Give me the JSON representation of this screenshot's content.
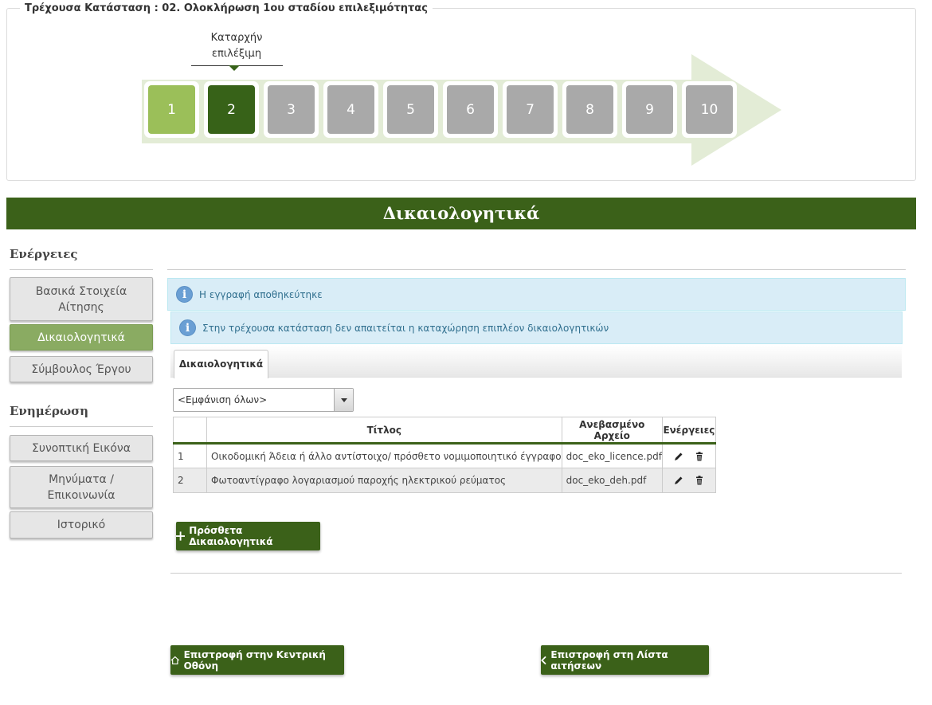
{
  "status": {
    "legend": "Τρέχουσα Κατάσταση : 02. Ολοκλήρωση 1ου σταδίου επιλεξιμότητας",
    "steps": [
      "1",
      "2",
      "3",
      "4",
      "5",
      "6",
      "7",
      "8",
      "9",
      "10"
    ],
    "completed_steps": [
      1
    ],
    "current_step": 2,
    "current_tooltip_line1": "Καταρχήν",
    "current_tooltip_line2": "επιλέξιμη"
  },
  "page_title": "Δικαιολογητικά",
  "sidebar": {
    "actions_heading": "Ενέργειες",
    "actions": [
      {
        "line1": "Βασικά Στοιχεία",
        "line2": "Αίτησης"
      },
      {
        "line1": "Δικαιολογητικά",
        "line2": ""
      },
      {
        "line1": "Σύμβουλος Έργου",
        "line2": ""
      }
    ],
    "active_action": 1,
    "info_heading": "Ενημέρωση",
    "info": [
      {
        "line1": "Συνοπτική Εικόνα",
        "line2": ""
      },
      {
        "line1": "Μηνύματα /",
        "line2": "Επικοινωνία"
      },
      {
        "line1": "Ιστορικό",
        "line2": ""
      }
    ]
  },
  "alerts": [
    "Η εγγραφή αποθηκεύτηκε",
    "Στην τρέχουσα κατάσταση δεν απαιτείται η καταχώρηση επιπλέον δικαιολογητικών"
  ],
  "tab_label": "Δικαιολογητικά",
  "filter": {
    "selected": "<Εμφάνιση όλων>"
  },
  "table": {
    "headers": [
      "",
      "Τίτλος",
      "Ανεβασμένο Αρχείο",
      "Ενέργειες"
    ],
    "rows": [
      {
        "num": "1",
        "title": "Οικοδομική Άδεια ή άλλο αντίστοιχο/ πρόσθετο νομιμοποιητικό έγγραφο",
        "file": "doc_eko_licence.pdf"
      },
      {
        "num": "2",
        "title": "Φωτοαντίγραφο λογαριασμού παροχής ηλεκτρικού ρεύματος",
        "file": "doc_eko_deh.pdf"
      }
    ]
  },
  "add_button": "Πρόσθετα Δικαιολογητικά",
  "home_button": "Επιστροφή στην Κεντρική Οθόνη",
  "back_button": "Επιστροφή στη Λίστα αιτήσεων",
  "colors": {
    "brand_green": "#3b6119",
    "step_done": "#9bbf59",
    "step_current": "#376218",
    "step_pending": "#a9a9a9",
    "alert_bg": "#d9edf7",
    "alert_text": "#31708f"
  }
}
